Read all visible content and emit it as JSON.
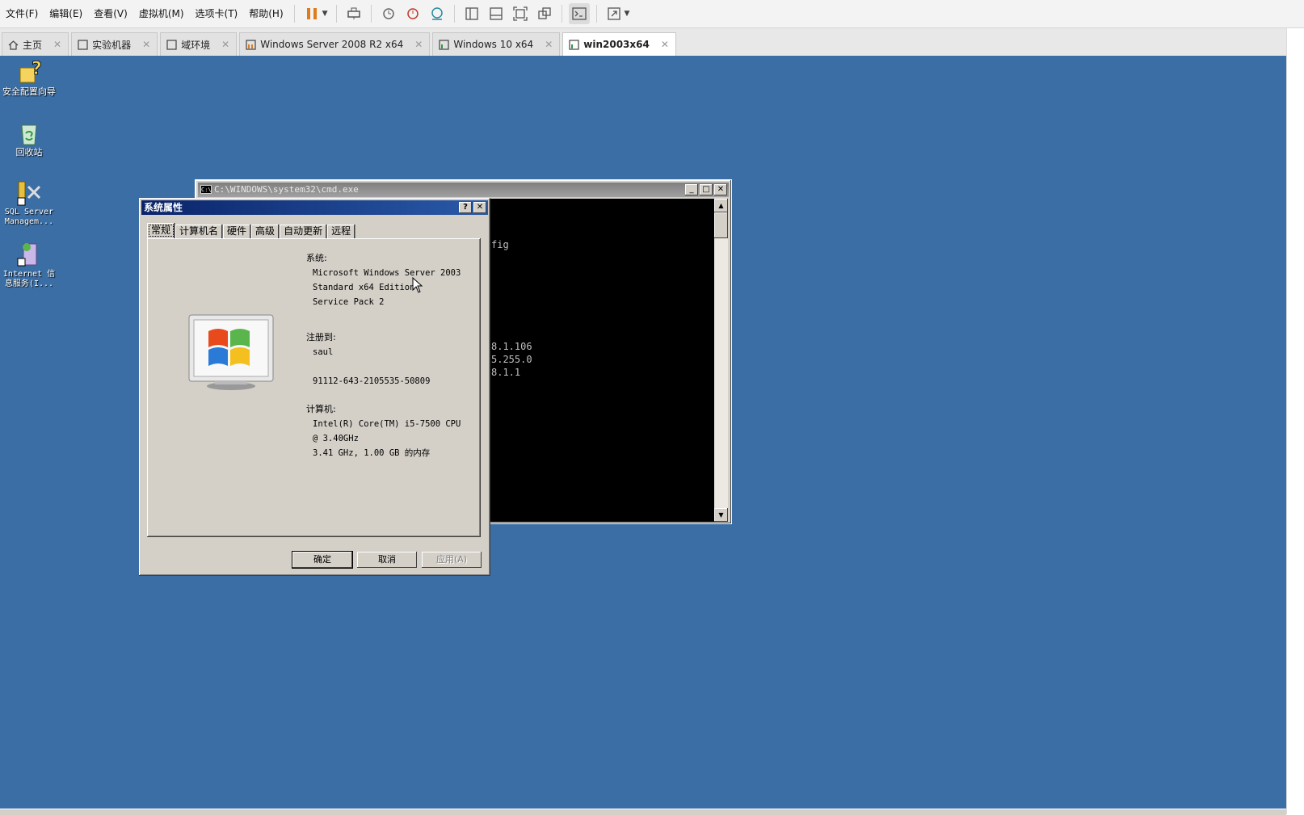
{
  "menubar": {
    "items": [
      "文件(F)",
      "编辑(E)",
      "查看(V)",
      "虚拟机(M)",
      "选项卡(T)",
      "帮助(H)"
    ]
  },
  "tabs": [
    {
      "label": "主页",
      "icon": "home-icon"
    },
    {
      "label": "实验机器",
      "icon": "vm-icon"
    },
    {
      "label": "域环境",
      "icon": "vm-icon"
    },
    {
      "label": "Windows Server 2008 R2 x64",
      "icon": "vm-running-icon"
    },
    {
      "label": "Windows 10 x64",
      "icon": "vm-running-icon"
    },
    {
      "label": "win2003x64",
      "icon": "vm-running-icon",
      "active": true
    }
  ],
  "desktop_icons": [
    {
      "label": "安全配置向导",
      "icon": "security-wizard-icon"
    },
    {
      "label": "回收站",
      "icon": "recycle-bin-icon"
    },
    {
      "label": "SQL Server Managem...",
      "icon": "sql-server-icon"
    },
    {
      "label": "Internet 信息服务(I...",
      "icon": "iis-icon"
    }
  ],
  "cmd": {
    "title": "C:\\WINDOWS\\system32\\cmd.exe",
    "lines": [
      "fig",
      "8.1.106",
      "5.255.0",
      "8.1.1"
    ]
  },
  "dialog": {
    "title": "系统属性",
    "tabs": [
      "常规",
      "计算机名",
      "硬件",
      "高级",
      "自动更新",
      "远程"
    ],
    "system_label": "系统:",
    "system_lines": [
      "Microsoft Windows Server 2003",
      "Standard x64 Edition",
      "Service Pack 2"
    ],
    "registered_label": "注册到:",
    "registered_user": "saul",
    "product_id": "91112-643-2105535-50809",
    "computer_label": "计算机:",
    "computer_lines": [
      "Intel(R) Core(TM) i5-7500 CPU",
      "@ 3.40GHz",
      "3.41 GHz, 1.00 GB 的内存"
    ],
    "ok": "确定",
    "cancel": "取消",
    "apply": "应用(A)"
  },
  "colors": {
    "desktop": "#3a6ea5",
    "dialog_title": "#0a246a",
    "vmware_pause": "#e07b1c"
  }
}
